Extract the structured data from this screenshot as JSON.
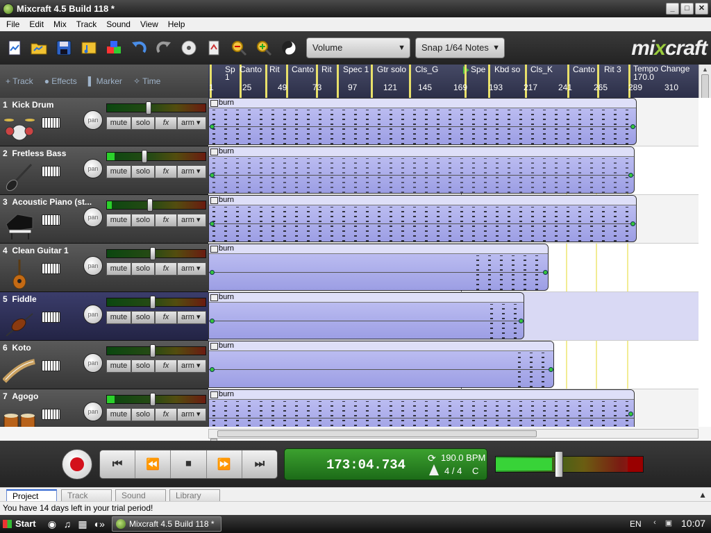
{
  "window": {
    "title": "Mixcraft 4.5 Build 118 *",
    "minimize": "_",
    "maximize": "□",
    "close": "✕"
  },
  "menu": [
    "File",
    "Edit",
    "Mix",
    "Track",
    "Sound",
    "View",
    "Help"
  ],
  "toolbar": {
    "icons": [
      "new-project-icon",
      "open-icon",
      "save-icon",
      "import-icon",
      "add-track-icon",
      "undo-icon",
      "redo-icon",
      "burn-cd-icon",
      "mixdown-icon",
      "zoom-out-icon",
      "zoom-in-icon",
      "metronome-icon"
    ],
    "automation_combo": "Volume",
    "snap_combo": "Snap 1/64 Notes",
    "logo_prefix": "mi",
    "logo_x": "x",
    "logo_suffix": "craft"
  },
  "track_header": {
    "add_track": "+ Track",
    "effects": "Effects",
    "marker": "Marker",
    "time": "Time"
  },
  "ruler": {
    "markers": [
      "Sp",
      "Canto",
      "Rit",
      "Canto",
      "Rit",
      "Spec 1",
      "Gtr solo",
      "Cls_G",
      "Spe",
      "Kbd so",
      "Cls_K",
      "Canto",
      "Rit 3",
      "Tempo Change 170.0"
    ],
    "sp_sub": "1",
    "bars": [
      "1",
      "25",
      "49",
      "73",
      "97",
      "121",
      "145",
      "169",
      "193",
      "217",
      "241",
      "265",
      "289",
      "310"
    ]
  },
  "track_buttons": {
    "pan": "pan",
    "mute": "mute",
    "solo": "solo",
    "fx": "fx",
    "arm": "arm",
    "arm_arrow": "▾"
  },
  "tracks": [
    {
      "num": "1",
      "name": "Kick Drum",
      "icon": "drum-kit-icon",
      "clip": "burn",
      "level": 0
    },
    {
      "num": "2",
      "name": "Fretless Bass",
      "icon": "bass-guitar-icon",
      "clip": "burn",
      "level": 0.08
    },
    {
      "num": "3",
      "name": "Acoustic Piano (st...",
      "icon": "piano-icon",
      "clip": "burn",
      "level": 0.05
    },
    {
      "num": "4",
      "name": "Clean Guitar 1",
      "icon": "acoustic-guitar-icon",
      "clip": "burn",
      "level": 0
    },
    {
      "num": "5",
      "name": "Fiddle",
      "icon": "violin-icon",
      "clip": "burn",
      "level": 0
    },
    {
      "num": "6",
      "name": "Koto",
      "icon": "koto-icon",
      "clip": "burn",
      "level": 0
    },
    {
      "num": "7",
      "name": "Agogo",
      "icon": "agogo-bells-icon",
      "clip": "burn",
      "level": 0.08
    }
  ],
  "transport": {
    "record": "record-icon",
    "go_start": "⏮",
    "rewind": "⏪",
    "stop": "⏹",
    "fast_forward": "⏩",
    "go_end": "⏭",
    "position": "173:04.734",
    "tempo": "190.0 BPM",
    "time_signature": "4 / 4",
    "key": "C",
    "master_level": 0.38
  },
  "tabs": [
    "Project",
    "Track",
    "Sound",
    "Library"
  ],
  "status": "You have 14 days left in your trial period!",
  "taskbar": {
    "start": "Start",
    "task": "Mixcraft 4.5 Build 118 *",
    "lang": "EN",
    "clock": "10:07"
  }
}
